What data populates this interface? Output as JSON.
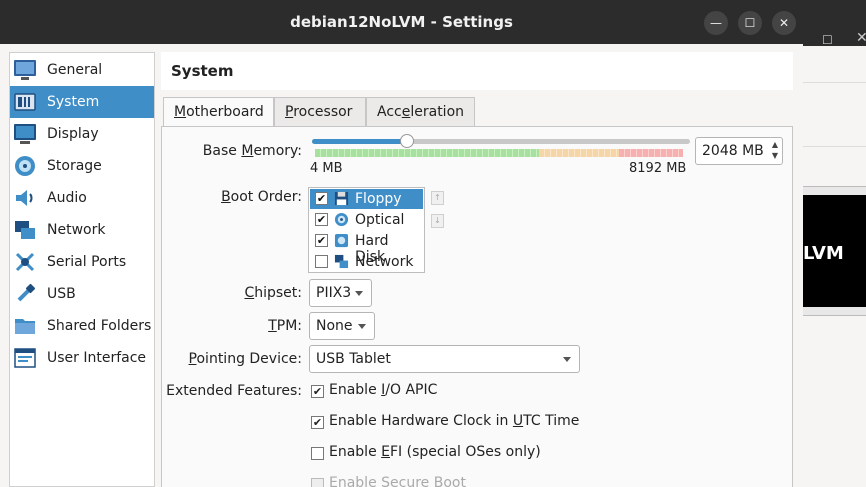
{
  "window": {
    "title": "debian12NoLVM - Settings"
  },
  "background_window": {
    "preview_text": "LVM"
  },
  "sidebar": {
    "items": [
      {
        "label": "General",
        "icon": "general-icon"
      },
      {
        "label": "System",
        "icon": "system-icon",
        "selected": true
      },
      {
        "label": "Display",
        "icon": "display-icon"
      },
      {
        "label": "Storage",
        "icon": "storage-icon"
      },
      {
        "label": "Audio",
        "icon": "audio-icon"
      },
      {
        "label": "Network",
        "icon": "network-icon"
      },
      {
        "label": "Serial Ports",
        "icon": "serial-ports-icon"
      },
      {
        "label": "USB",
        "icon": "usb-icon"
      },
      {
        "label": "Shared Folders",
        "icon": "shared-folders-icon"
      },
      {
        "label": "User Interface",
        "icon": "user-interface-icon"
      }
    ]
  },
  "page": {
    "title": "System",
    "tabs": [
      {
        "label_pre": "",
        "label_ul": "M",
        "label_post": "otherboard",
        "active": true
      },
      {
        "label_pre": "",
        "label_ul": "P",
        "label_post": "rocessor"
      },
      {
        "label_pre": "Acc",
        "label_ul": "e",
        "label_post": "leration"
      }
    ]
  },
  "motherboard": {
    "base_memory": {
      "label_pre": "Base ",
      "label_ul": "M",
      "label_post": "emory:",
      "value": "2048 MB",
      "value_fraction": 0.25,
      "min_label": "4 MB",
      "max_label": "8192 MB"
    },
    "boot_order": {
      "label_pre": "",
      "label_ul": "B",
      "label_post": "oot Order:",
      "items": [
        {
          "label": "Floppy",
          "checked": true,
          "selected": true
        },
        {
          "label": "Optical",
          "checked": true
        },
        {
          "label": "Hard Disk",
          "checked": true
        },
        {
          "label": "Network",
          "checked": false
        }
      ]
    },
    "chipset": {
      "label_pre": "",
      "label_ul": "C",
      "label_post": "hipset:",
      "value": "PIIX3"
    },
    "tpm": {
      "label_pre": "",
      "label_ul": "T",
      "label_post": "PM:",
      "value": "None"
    },
    "pointing_device": {
      "label_pre": "",
      "label_ul": "P",
      "label_post": "ointing Device:",
      "value": "USB Tablet"
    },
    "extended_features": {
      "label": "Extended Features:",
      "options": [
        {
          "pre": "Enable ",
          "ul": "I",
          "post": "/O APIC",
          "checked": true,
          "disabled": false
        },
        {
          "pre": "Enable Hardware Clock in ",
          "ul": "U",
          "post": "TC Time",
          "checked": true,
          "disabled": false
        },
        {
          "pre": "Enable ",
          "ul": "E",
          "post": "FI (special OSes only)",
          "checked": false,
          "disabled": false
        },
        {
          "pre": "Enable Secure Boot",
          "ul": "",
          "post": "",
          "checked": false,
          "disabled": true
        }
      ]
    }
  },
  "colors": {
    "accent": "#3f8ec8",
    "titlebar": "#2c2c2c"
  }
}
